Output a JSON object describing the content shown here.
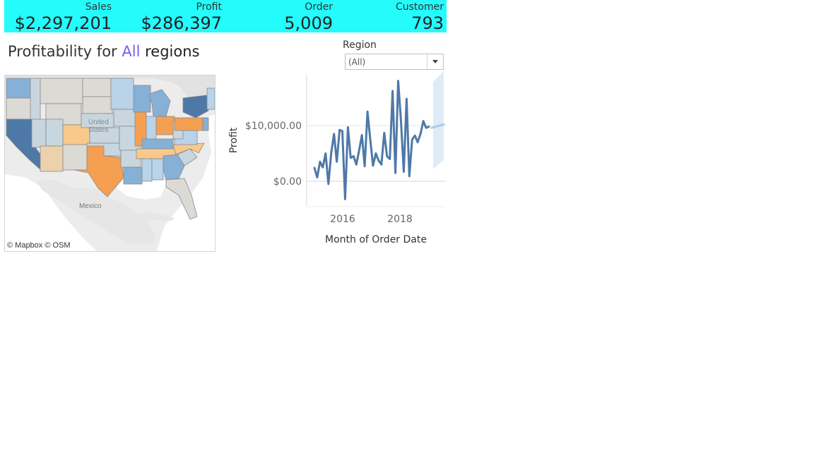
{
  "kpis": [
    {
      "label": "Sales",
      "value": "$2,297,201"
    },
    {
      "label": "Profit",
      "value": "$286,397"
    },
    {
      "label": "Order",
      "value": "5,009"
    },
    {
      "label": "Customer",
      "value": "793"
    }
  ],
  "kpi_bar_color": "#24fbfb",
  "title": {
    "prefix": "Profitability for ",
    "highlight": "All",
    "suffix": " regions",
    "highlight_color": "#7b5cf0"
  },
  "filter": {
    "label": "Region",
    "value": "(All)"
  },
  "map": {
    "credit": "© Mapbox © OSM",
    "labels": {
      "country_us": "United States",
      "country_mx": "Mexico"
    },
    "colors": {
      "dark_blue": "#4e79a7",
      "mid_blue": "#86b0d6",
      "light_blue": "#b9d3e9",
      "gray_blue": "#c8d6df",
      "neutral": "#dcdad4",
      "orange": "#f59f52",
      "light_orange": "#f8c98a",
      "peach": "#ecd1ad"
    }
  },
  "chart_data": {
    "type": "line",
    "ylabel": "Profit",
    "xlabel": "Month of Order Date",
    "x_ticks": [
      "2016",
      "2018"
    ],
    "y_ticks": [
      "$0.00",
      "$10,000.00"
    ],
    "series": [
      {
        "values": [
          2400,
          700,
          3500,
          2500,
          5000,
          -500,
          5000,
          8500,
          3500,
          9200,
          9000,
          -3200,
          9700,
          4200,
          4500,
          3000,
          5500,
          8300,
          2700,
          12500,
          7500,
          2800,
          5000,
          3700,
          3000,
          8700,
          4500,
          4000,
          16200,
          1500,
          18000,
          11000,
          1700,
          14800,
          900,
          7500,
          8200,
          7000,
          8500,
          10800,
          9600,
          9800
        ]
      }
    ],
    "forecast": {
      "values": [
        9600,
        10200
      ],
      "band_low": 2200,
      "band_high": 17800
    },
    "line_color": "#4e79a7",
    "forecast_color": "#aacde6",
    "band_color": "#dbe9f6"
  }
}
